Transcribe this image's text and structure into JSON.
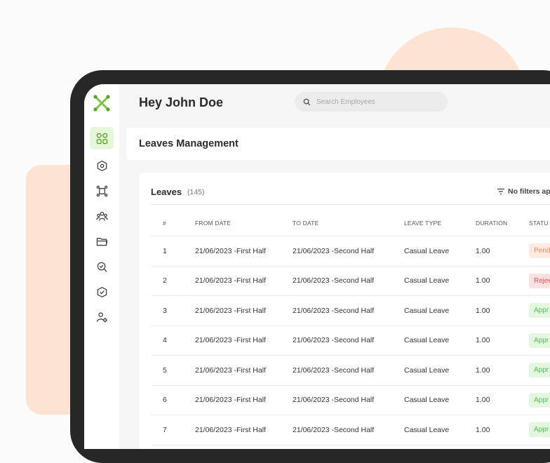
{
  "app": {
    "greeting": "Hey John Doe"
  },
  "search": {
    "placeholder": "Search Employees"
  },
  "page": {
    "title": "Leaves Management"
  },
  "leaves": {
    "title": "Leaves",
    "count": "(145)",
    "filter_label": "No filters ap",
    "columns": [
      "#",
      "FROM DATE",
      "TO DATE",
      "LEAVE TYPE",
      "DURATION",
      "STATU"
    ],
    "rows": [
      {
        "num": "1",
        "from": "21/06/2023 -First Half",
        "to": "21/06/2023 -Second Half",
        "type": "Casual Leave",
        "duration": "1.00",
        "status": "Pend",
        "status_kind": "pending"
      },
      {
        "num": "2",
        "from": "21/06/2023 -First Half",
        "to": "21/06/2023 -Second Half",
        "type": "Casual Leave",
        "duration": "1.00",
        "status": "Rejec",
        "status_kind": "rejected"
      },
      {
        "num": "3",
        "from": "21/06/2023 -First Half",
        "to": "21/06/2023 -Second Half",
        "type": "Casual Leave",
        "duration": "1.00",
        "status": "Appr",
        "status_kind": "approved"
      },
      {
        "num": "4",
        "from": "21/06/2023 -First Half",
        "to": "21/06/2023 -Second Half",
        "type": "Casual Leave",
        "duration": "1.00",
        "status": "Appr",
        "status_kind": "approved"
      },
      {
        "num": "5",
        "from": "21/06/2023 -First Half",
        "to": "21/06/2023 -Second Half",
        "type": "Casual Leave",
        "duration": "1.00",
        "status": "Appr",
        "status_kind": "approved"
      },
      {
        "num": "6",
        "from": "21/06/2023 -First Half",
        "to": "21/06/2023 -Second Half",
        "type": "Casual Leave",
        "duration": "1.00",
        "status": "Appr",
        "status_kind": "approved"
      },
      {
        "num": "7",
        "from": "21/06/2023 -First Half",
        "to": "21/06/2023 -Second Half",
        "type": "Casual Leave",
        "duration": "1.00",
        "status": "Appr",
        "status_kind": "approved"
      }
    ]
  },
  "sidebar": {
    "items": [
      {
        "icon": "dashboard-icon",
        "active": true
      },
      {
        "icon": "home-shield-icon",
        "active": false
      },
      {
        "icon": "network-icon",
        "active": false
      },
      {
        "icon": "team-icon",
        "active": false
      },
      {
        "icon": "folder-icon",
        "active": false
      },
      {
        "icon": "search-check-icon",
        "active": false
      },
      {
        "icon": "check-circle-icon",
        "active": false
      },
      {
        "icon": "user-settings-icon",
        "active": false
      }
    ]
  },
  "colors": {
    "accent": "#7cc342",
    "pending": "#ef8a5a",
    "rejected": "#e15353",
    "approved": "#5cb85c",
    "decor": "#fde3d2"
  }
}
